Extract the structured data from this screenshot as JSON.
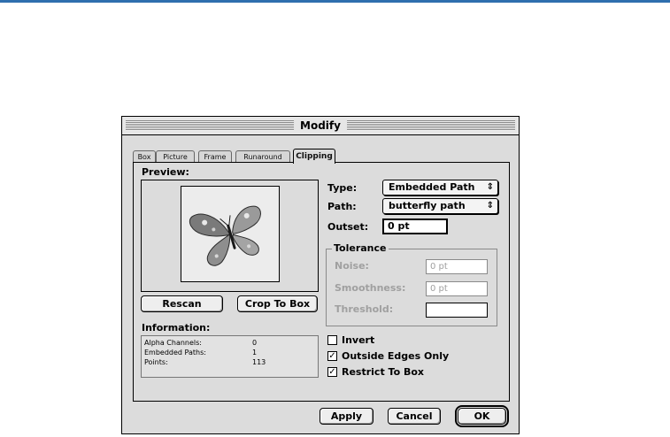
{
  "window": {
    "title": "Modify"
  },
  "tabs": [
    "Box",
    "Picture",
    "Frame",
    "Runaround",
    "Clipping"
  ],
  "active_tab": "Clipping",
  "preview": {
    "label": "Preview:"
  },
  "buttons": {
    "rescan": "Rescan",
    "crop_to_box": "Crop To Box",
    "apply": "Apply",
    "cancel": "Cancel",
    "ok": "OK"
  },
  "information": {
    "label": "Information:",
    "rows": [
      {
        "key": "Alpha Channels:",
        "value": "0"
      },
      {
        "key": "Embedded Paths:",
        "value": "1"
      },
      {
        "key": "Points:",
        "value": "113"
      }
    ]
  },
  "type": {
    "label": "Type:",
    "value": "Embedded Path"
  },
  "path": {
    "label": "Path:",
    "value": "butterfly path"
  },
  "outset": {
    "label": "Outset:",
    "value": "0 pt"
  },
  "tolerance": {
    "label": "Tolerance",
    "noise": {
      "label": "Noise:",
      "value": "0 pt"
    },
    "smoothness": {
      "label": "Smoothness:",
      "value": "0 pt"
    },
    "threshold": {
      "label": "Threshold:",
      "value": ""
    }
  },
  "options": [
    {
      "label": "Invert",
      "checked": false
    },
    {
      "label": "Outside Edges Only",
      "checked": true
    },
    {
      "label": "Restrict To Box",
      "checked": true
    }
  ],
  "icons": {
    "popup_arrow": "up-down-arrows",
    "check": "checkmark"
  }
}
